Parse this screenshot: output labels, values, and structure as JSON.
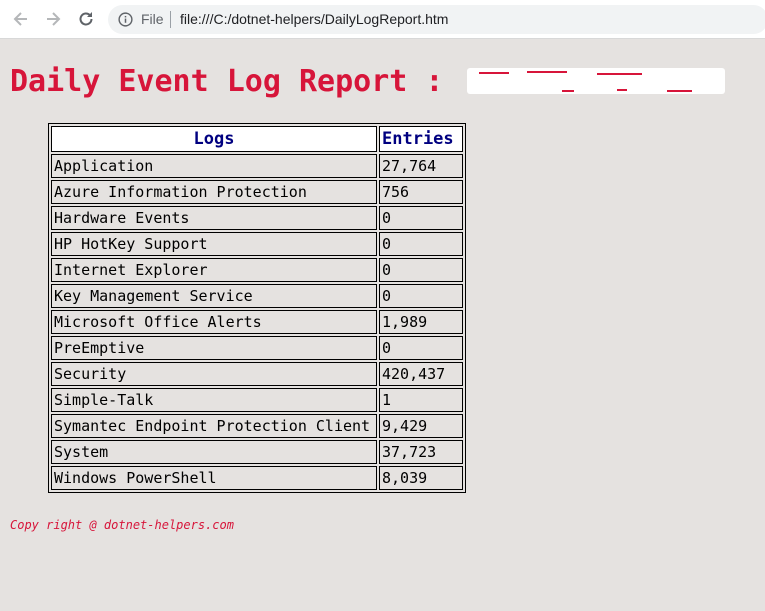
{
  "browser": {
    "scheme_label": "File",
    "url": "file:///C:/dotnet-helpers/DailyLogReport.htm",
    "back_icon": "arrow-left-icon",
    "forward_icon": "arrow-right-icon",
    "reload_icon": "reload-icon",
    "info_icon": "info-icon"
  },
  "page": {
    "title": "Daily Event Log Report : ",
    "title_color": "#d7153a",
    "background": "#e5e2e0"
  },
  "table": {
    "headers": {
      "logs": "Logs",
      "entries": "Entries"
    },
    "header_color": "#000080",
    "rows": [
      {
        "log": "Application",
        "entries": "27,764"
      },
      {
        "log": "Azure Information Protection",
        "entries": "756"
      },
      {
        "log": "Hardware Events",
        "entries": "0"
      },
      {
        "log": "HP HotKey Support",
        "entries": "0"
      },
      {
        "log": "Internet Explorer",
        "entries": "0"
      },
      {
        "log": "Key Management Service",
        "entries": "0"
      },
      {
        "log": "Microsoft Office Alerts",
        "entries": "1,989"
      },
      {
        "log": "PreEmptive",
        "entries": "0"
      },
      {
        "log": "Security",
        "entries": "420,437"
      },
      {
        "log": "Simple-Talk",
        "entries": "1"
      },
      {
        "log": "Symantec Endpoint Protection Client",
        "entries": "9,429"
      },
      {
        "log": "System",
        "entries": "37,723"
      },
      {
        "log": "Windows PowerShell",
        "entries": "8,039"
      }
    ]
  },
  "footer": {
    "copyright": "Copy right @ dotnet-helpers.com"
  }
}
